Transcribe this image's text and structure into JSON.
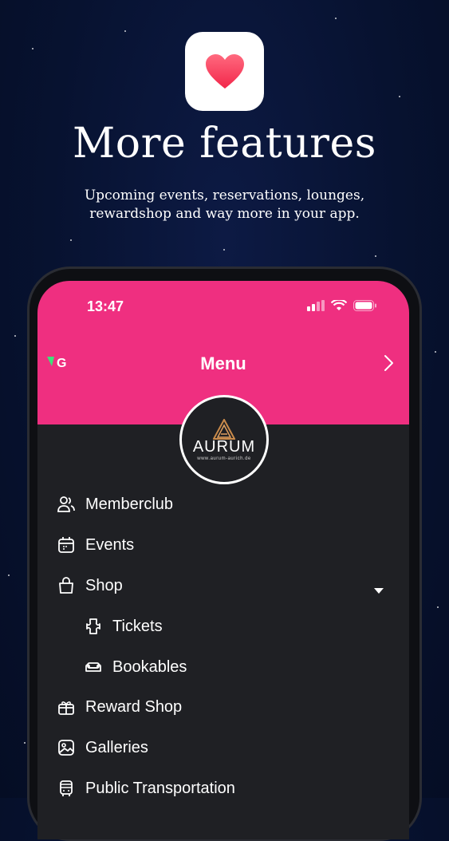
{
  "promo": {
    "title": "More features",
    "subtitle_line1": "Upcoming events, reservations, lounges,",
    "subtitle_line2": "rewardshop and way more in your app."
  },
  "status_bar": {
    "time": "13:47"
  },
  "header": {
    "title": "Menu",
    "accent_color": "#ef2f80",
    "brand_logo_text": "G"
  },
  "club": {
    "name": "AURUM",
    "url": "www.aurum-aurich.de"
  },
  "menu": {
    "items": [
      {
        "label": "Memberclub",
        "icon": "users-icon"
      },
      {
        "label": "Events",
        "icon": "calendar-icon"
      },
      {
        "label": "Shop",
        "icon": "bag-icon"
      },
      {
        "label": "Tickets",
        "icon": "ticket-icon"
      },
      {
        "label": "Bookables",
        "icon": "sofa-icon"
      },
      {
        "label": "Reward Shop",
        "icon": "gift-icon"
      },
      {
        "label": "Galleries",
        "icon": "image-icon"
      },
      {
        "label": "Public Transportation",
        "icon": "bus-icon"
      }
    ]
  }
}
